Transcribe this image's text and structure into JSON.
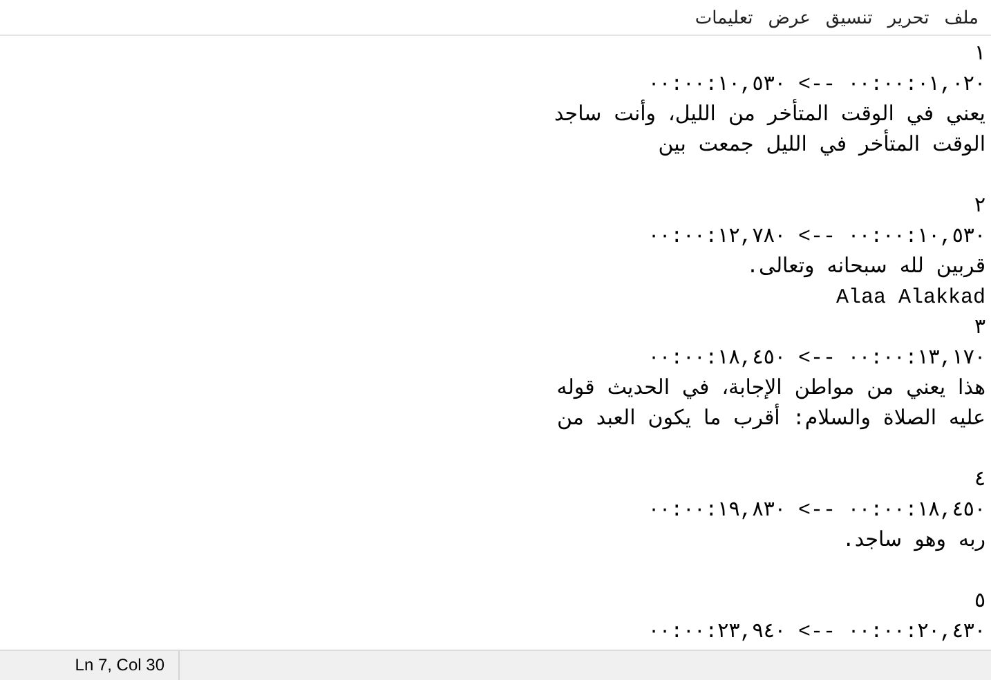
{
  "menu": [
    {
      "label": "ملف"
    },
    {
      "label": "تحرير"
    },
    {
      "label": "تنسيق"
    },
    {
      "label": "عرض"
    },
    {
      "label": "تعليمات"
    }
  ],
  "lines": [
    {
      "kind": "text",
      "text": "١"
    },
    {
      "kind": "text",
      "text": "٠٠:٠٠:٠١,٠٢٠ --> ٠٠:٠٠:١٠,٥٣٠"
    },
    {
      "kind": "text",
      "text": "يعني في الوقت المتأخر من الليل، وأنت ساجد"
    },
    {
      "kind": "text",
      "text": "الوقت المتأخر في الليل جمعت بين"
    },
    {
      "kind": "blank"
    },
    {
      "kind": "text",
      "text": "٢"
    },
    {
      "kind": "text",
      "text": "٠٠:٠٠:١٠,٥٣٠ --> ٠٠:٠٠:١٢,٧٨٠"
    },
    {
      "kind": "text",
      "text": "قربين لله سبحانه وتعالى."
    },
    {
      "kind": "text",
      "text": "Alaa Alakkad"
    },
    {
      "kind": "text",
      "text": "٣"
    },
    {
      "kind": "text",
      "text": "٠٠:٠٠:١٣,١٧٠ --> ٠٠:٠٠:١٨,٤٥٠"
    },
    {
      "kind": "text",
      "text": "هذا يعني من مواطن الإجابة، في الحديث قوله"
    },
    {
      "kind": "text",
      "text": "عليه الصلاة والسلام: أقرب ما يكون العبد من"
    },
    {
      "kind": "blank"
    },
    {
      "kind": "text",
      "text": "٤"
    },
    {
      "kind": "text",
      "text": "٠٠:٠٠:١٨,٤٥٠ --> ٠٠:٠٠:١٩,٨٣٠"
    },
    {
      "kind": "text",
      "text": "ربه وهو ساجد."
    },
    {
      "kind": "blank"
    },
    {
      "kind": "text",
      "text": "٥"
    },
    {
      "kind": "text",
      "text": "٠٠:٠٠:٢٠,٤٣٠ --> ٠٠:٠٠:٢٣,٩٤٠"
    }
  ],
  "status_bar": {
    "position": "Ln 7, Col 30"
  }
}
